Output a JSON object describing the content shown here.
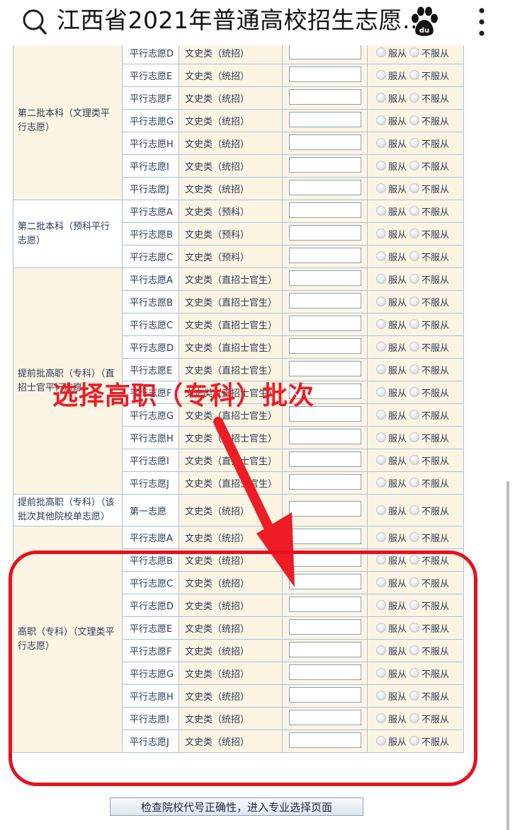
{
  "browser": {
    "title": "江西省2021年普通高校招生志愿...",
    "search_icon": "search-icon",
    "logo_icon": "baidu-paw-icon",
    "menu_icon": "more-vertical-icon"
  },
  "form": {
    "groups": [
      {
        "label": "第二批本科（文理类平行志愿）",
        "rows": [
          {
            "name": "平行志愿D",
            "type": "文史类（统招）"
          },
          {
            "name": "平行志愿E",
            "type": "文史类（统招）"
          },
          {
            "name": "平行志愿F",
            "type": "文史类（统招）"
          },
          {
            "name": "平行志愿G",
            "type": "文史类（统招）"
          },
          {
            "name": "平行志愿H",
            "type": "文史类（统招）"
          },
          {
            "name": "平行志愿I",
            "type": "文史类（统招）"
          },
          {
            "name": "平行志愿J",
            "type": "文史类（统招）"
          }
        ]
      },
      {
        "label": "第二批本科（预科平行志愿）",
        "rows": [
          {
            "name": "平行志愿A",
            "type": "文史类（预科）"
          },
          {
            "name": "平行志愿B",
            "type": "文史类（预科）"
          },
          {
            "name": "平行志愿C",
            "type": "文史类（预科）"
          }
        ]
      },
      {
        "label": "提前批高职（专科）（直招士官平行志愿）",
        "rows": [
          {
            "name": "平行志愿A",
            "type": "文史类（直招士官生）"
          },
          {
            "name": "平行志愿B",
            "type": "文史类（直招士官生）"
          },
          {
            "name": "平行志愿C",
            "type": "文史类（直招士官生）"
          },
          {
            "name": "平行志愿D",
            "type": "文史类（直招士官生）"
          },
          {
            "name": "平行志愿E",
            "type": "文史类（直招士官生）"
          },
          {
            "name": "平行志愿F",
            "type": "文史类（直招士官生）"
          },
          {
            "name": "平行志愿G",
            "type": "文史类（直招士官生）"
          },
          {
            "name": "平行志愿H",
            "type": "文史类（直招士官生）"
          },
          {
            "name": "平行志愿I",
            "type": "文史类（直招士官生）"
          },
          {
            "name": "平行志愿J",
            "type": "文史类（直招士官生）"
          }
        ]
      },
      {
        "label": "提前批高职（专科）（该批次其他院校单志愿）",
        "rows": [
          {
            "name": "第一志愿",
            "type": "文史类（统招）"
          }
        ]
      },
      {
        "label": "高职（专科）（文理类平行志愿）",
        "rows": [
          {
            "name": "平行志愿A",
            "type": "文史类（统招）"
          },
          {
            "name": "平行志愿B",
            "type": "文史类（统招）"
          },
          {
            "name": "平行志愿C",
            "type": "文史类（统招）"
          },
          {
            "name": "平行志愿D",
            "type": "文史类（统招）"
          },
          {
            "name": "平行志愿E",
            "type": "文史类（统招）"
          },
          {
            "name": "平行志愿F",
            "type": "文史类（统招）"
          },
          {
            "name": "平行志愿G",
            "type": "文史类（统招）"
          },
          {
            "name": "平行志愿H",
            "type": "文史类（统招）"
          },
          {
            "name": "平行志愿I",
            "type": "文史类（统招）"
          },
          {
            "name": "平行志愿J",
            "type": "文史类（统招）"
          }
        ]
      }
    ],
    "radio_yes": "服从",
    "radio_no": "不服从",
    "code_value": ""
  },
  "button": {
    "label": "检查院校代号正确性，进入专业选择页面"
  },
  "annotation": {
    "text": "选择高职（专科）批次",
    "color": "#ee1c25"
  },
  "colors": {
    "cell_bg": "#fdf5e4",
    "border": "#a9c2d8",
    "text": "#2a3a55"
  }
}
